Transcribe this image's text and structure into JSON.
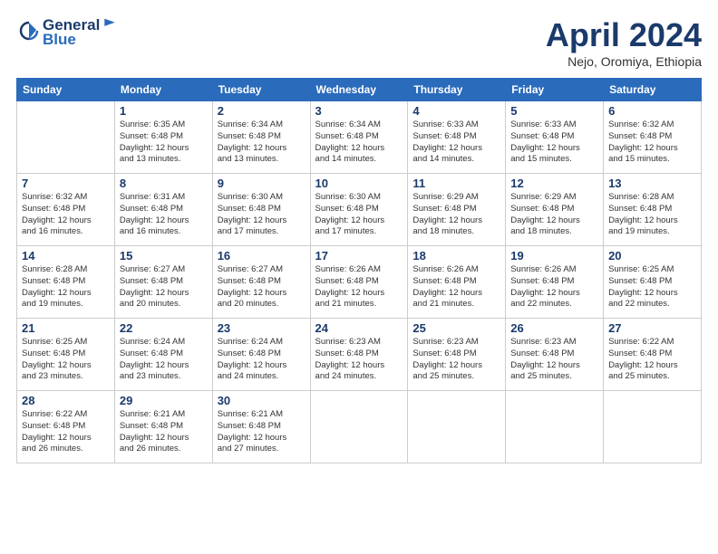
{
  "header": {
    "logo_general": "General",
    "logo_blue": "Blue",
    "month": "April 2024",
    "location": "Nejo, Oromiya, Ethiopia"
  },
  "weekdays": [
    "Sunday",
    "Monday",
    "Tuesday",
    "Wednesday",
    "Thursday",
    "Friday",
    "Saturday"
  ],
  "weeks": [
    [
      {
        "day": null
      },
      {
        "day": "1",
        "sunrise": "6:35 AM",
        "sunset": "6:48 PM",
        "daylight": "12 hours and 13 minutes."
      },
      {
        "day": "2",
        "sunrise": "6:34 AM",
        "sunset": "6:48 PM",
        "daylight": "12 hours and 13 minutes."
      },
      {
        "day": "3",
        "sunrise": "6:34 AM",
        "sunset": "6:48 PM",
        "daylight": "12 hours and 14 minutes."
      },
      {
        "day": "4",
        "sunrise": "6:33 AM",
        "sunset": "6:48 PM",
        "daylight": "12 hours and 14 minutes."
      },
      {
        "day": "5",
        "sunrise": "6:33 AM",
        "sunset": "6:48 PM",
        "daylight": "12 hours and 15 minutes."
      },
      {
        "day": "6",
        "sunrise": "6:32 AM",
        "sunset": "6:48 PM",
        "daylight": "12 hours and 15 minutes."
      }
    ],
    [
      {
        "day": "7",
        "sunrise": "6:32 AM",
        "sunset": "6:48 PM",
        "daylight": "12 hours and 16 minutes."
      },
      {
        "day": "8",
        "sunrise": "6:31 AM",
        "sunset": "6:48 PM",
        "daylight": "12 hours and 16 minutes."
      },
      {
        "day": "9",
        "sunrise": "6:30 AM",
        "sunset": "6:48 PM",
        "daylight": "12 hours and 17 minutes."
      },
      {
        "day": "10",
        "sunrise": "6:30 AM",
        "sunset": "6:48 PM",
        "daylight": "12 hours and 17 minutes."
      },
      {
        "day": "11",
        "sunrise": "6:29 AM",
        "sunset": "6:48 PM",
        "daylight": "12 hours and 18 minutes."
      },
      {
        "day": "12",
        "sunrise": "6:29 AM",
        "sunset": "6:48 PM",
        "daylight": "12 hours and 18 minutes."
      },
      {
        "day": "13",
        "sunrise": "6:28 AM",
        "sunset": "6:48 PM",
        "daylight": "12 hours and 19 minutes."
      }
    ],
    [
      {
        "day": "14",
        "sunrise": "6:28 AM",
        "sunset": "6:48 PM",
        "daylight": "12 hours and 19 minutes."
      },
      {
        "day": "15",
        "sunrise": "6:27 AM",
        "sunset": "6:48 PM",
        "daylight": "12 hours and 20 minutes."
      },
      {
        "day": "16",
        "sunrise": "6:27 AM",
        "sunset": "6:48 PM",
        "daylight": "12 hours and 20 minutes."
      },
      {
        "day": "17",
        "sunrise": "6:26 AM",
        "sunset": "6:48 PM",
        "daylight": "12 hours and 21 minutes."
      },
      {
        "day": "18",
        "sunrise": "6:26 AM",
        "sunset": "6:48 PM",
        "daylight": "12 hours and 21 minutes."
      },
      {
        "day": "19",
        "sunrise": "6:26 AM",
        "sunset": "6:48 PM",
        "daylight": "12 hours and 22 minutes."
      },
      {
        "day": "20",
        "sunrise": "6:25 AM",
        "sunset": "6:48 PM",
        "daylight": "12 hours and 22 minutes."
      }
    ],
    [
      {
        "day": "21",
        "sunrise": "6:25 AM",
        "sunset": "6:48 PM",
        "daylight": "12 hours and 23 minutes."
      },
      {
        "day": "22",
        "sunrise": "6:24 AM",
        "sunset": "6:48 PM",
        "daylight": "12 hours and 23 minutes."
      },
      {
        "day": "23",
        "sunrise": "6:24 AM",
        "sunset": "6:48 PM",
        "daylight": "12 hours and 24 minutes."
      },
      {
        "day": "24",
        "sunrise": "6:23 AM",
        "sunset": "6:48 PM",
        "daylight": "12 hours and 24 minutes."
      },
      {
        "day": "25",
        "sunrise": "6:23 AM",
        "sunset": "6:48 PM",
        "daylight": "12 hours and 25 minutes."
      },
      {
        "day": "26",
        "sunrise": "6:23 AM",
        "sunset": "6:48 PM",
        "daylight": "12 hours and 25 minutes."
      },
      {
        "day": "27",
        "sunrise": "6:22 AM",
        "sunset": "6:48 PM",
        "daylight": "12 hours and 25 minutes."
      }
    ],
    [
      {
        "day": "28",
        "sunrise": "6:22 AM",
        "sunset": "6:48 PM",
        "daylight": "12 hours and 26 minutes."
      },
      {
        "day": "29",
        "sunrise": "6:21 AM",
        "sunset": "6:48 PM",
        "daylight": "12 hours and 26 minutes."
      },
      {
        "day": "30",
        "sunrise": "6:21 AM",
        "sunset": "6:48 PM",
        "daylight": "12 hours and 27 minutes."
      },
      {
        "day": null
      },
      {
        "day": null
      },
      {
        "day": null
      },
      {
        "day": null
      }
    ]
  ]
}
